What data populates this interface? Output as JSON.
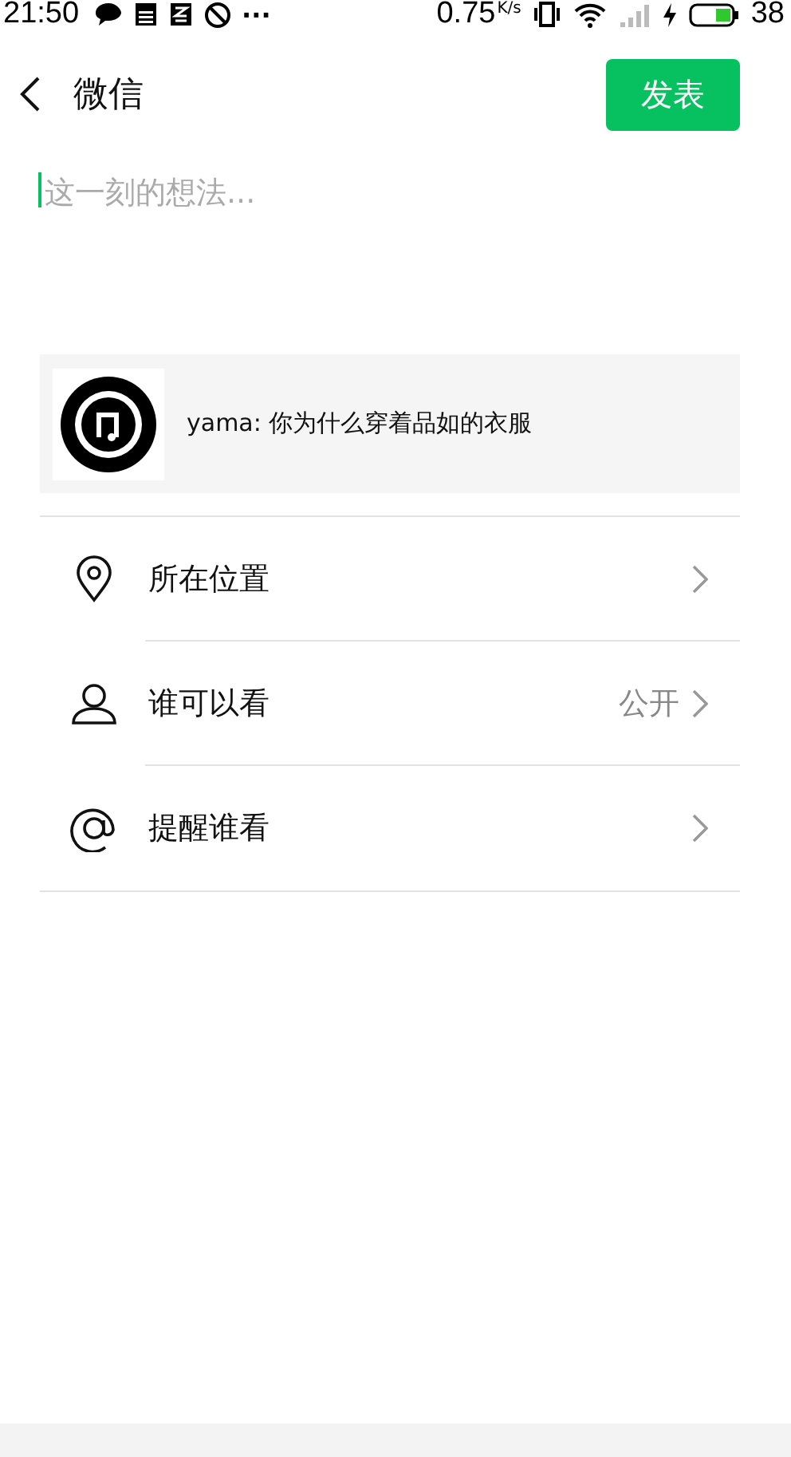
{
  "status_bar": {
    "time": "21:50",
    "notification_more": "···",
    "speed": "0.75",
    "speed_unit": "K/s",
    "battery": "38"
  },
  "header": {
    "title": "微信",
    "publish_button": "发表"
  },
  "composer": {
    "placeholder": "这一刻的想法..."
  },
  "shared_link": {
    "text": "yama: 你为什么穿着品如的衣服"
  },
  "options": [
    {
      "kind": "location",
      "label": "所在位置"
    },
    {
      "kind": "visibility",
      "label": "谁可以看",
      "value": "公开"
    },
    {
      "kind": "mention",
      "label": "提醒谁看"
    }
  ]
}
